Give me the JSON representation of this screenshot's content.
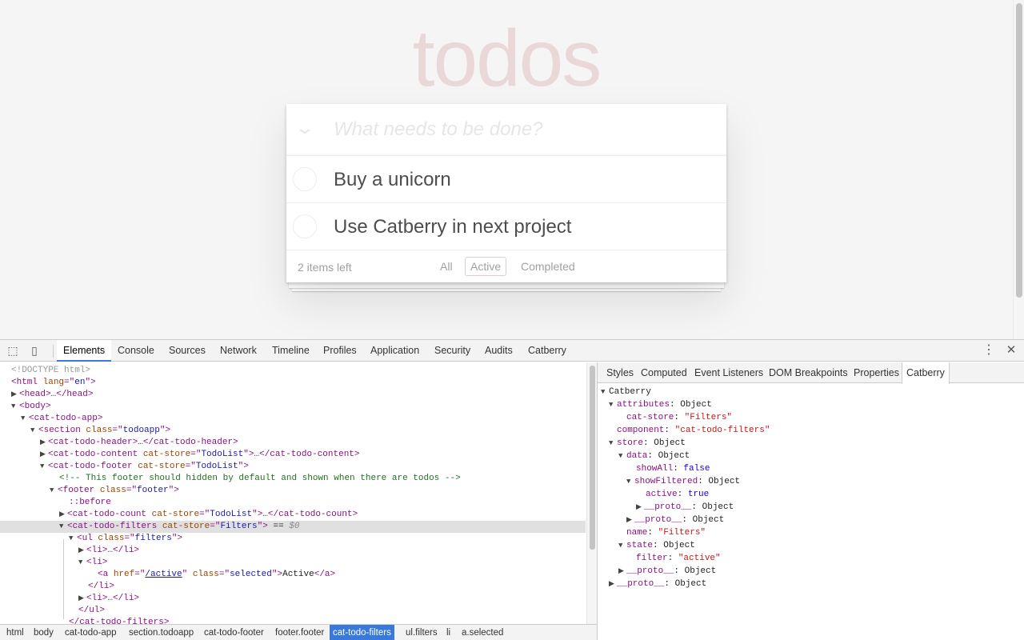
{
  "app": {
    "title": "todos",
    "new_todo_placeholder": "What needs to be done?",
    "toggle_all_glyph": "❯",
    "todos": [
      {
        "text": "Buy a unicorn",
        "completed": false
      },
      {
        "text": "Use Catberry in next project",
        "completed": false
      }
    ],
    "footer": {
      "count": "2 items left",
      "filters": [
        {
          "label": "All",
          "selected": false
        },
        {
          "label": "Active",
          "selected": true
        },
        {
          "label": "Completed",
          "selected": false
        }
      ]
    }
  },
  "devtools": {
    "tabs": [
      "Elements",
      "Console",
      "Sources",
      "Network",
      "Timeline",
      "Profiles",
      "Application",
      "Security",
      "Audits",
      "Catberry"
    ],
    "active_tab": "Elements",
    "icons": {
      "inspect": "inspect-icon",
      "device": "device-icon",
      "more": "more-vertical-icon",
      "close": "close-icon"
    },
    "dom": [
      {
        "t": "<!DOCTYPE html>"
      },
      {
        "a": "<",
        "b": "html",
        "c": " lang",
        "d": "=\"",
        "e": "en",
        "f": "\">"
      },
      {
        "tag": "<head>",
        "ell": "…",
        "close": "</head>"
      },
      {
        "tag": "<body>"
      },
      {
        "tag": "<cat-todo-app>"
      },
      {
        "tag": "<section",
        "attr": "class",
        "val": "todoapp",
        "end": ">"
      },
      {
        "tag": "<cat-todo-header>",
        "ell": "…",
        "close": "</cat-todo-header>"
      },
      {
        "tag": "<cat-todo-content",
        "attr": "cat-store",
        "val": "TodoList",
        "end": ">",
        "ell": "…",
        "close": "</cat-todo-content>"
      },
      {
        "tag": "<cat-todo-footer",
        "attr": "cat-store",
        "val": "TodoList",
        "end": ">"
      },
      {
        "comment": "<!-- This footer should hidden by default and shown when there are todos -->"
      },
      {
        "tag": "<footer",
        "attr": "class",
        "val": "footer",
        "end": ">"
      },
      {
        "pseudo": "::before"
      },
      {
        "tag": "<cat-todo-count",
        "attr": "cat-store",
        "val": "TodoList",
        "end": ">",
        "ell": "…",
        "close": "</cat-todo-count>"
      },
      {
        "tag": "<cat-todo-filters",
        "attr": "cat-store",
        "val": "Filters",
        "end": ">",
        "eq": " == ",
        "dollar": "$0"
      },
      {
        "tag": "<ul",
        "attr": "class",
        "val": "filters",
        "end": ">"
      },
      {
        "tag": "<li>",
        "ell": "…",
        "close": "</li>"
      },
      {
        "tag": "<li>"
      },
      {
        "tag": "<a",
        "attr": "href",
        "val": "/active",
        "attr2": "class",
        "val2": "selected",
        "end": ">",
        "text": "Active",
        "close": "</a>"
      },
      {
        "tag": "</li>"
      },
      {
        "tag": "<li>",
        "ell": "…",
        "close": "</li>"
      },
      {
        "tag": "</ul>"
      },
      {
        "tag": "</cat-todo-filters>"
      }
    ],
    "breadcrumbs": [
      "html",
      "body",
      "cat-todo-app",
      "section.todoapp",
      "cat-todo-footer",
      "footer.footer",
      "cat-todo-filters",
      "ul.filters",
      "li",
      "a.selected"
    ],
    "active_breadcrumb": "cat-todo-filters",
    "sidebar_tabs": [
      "Styles",
      "Computed",
      "Event Listeners",
      "DOM Breakpoints",
      "Properties",
      "Catberry"
    ],
    "active_sidebar_tab": "Catberry",
    "catberry_tree": [
      {
        "k": "Catberry"
      },
      {
        "k": "attributes",
        "v": "Object"
      },
      {
        "k": "cat-store",
        "s": "\"Filters\""
      },
      {
        "k": "component",
        "s": "\"cat-todo-filters\""
      },
      {
        "k": "store",
        "v": "Object"
      },
      {
        "k": "data",
        "v": "Object"
      },
      {
        "k": "showAll",
        "b": "false"
      },
      {
        "k": "showFiltered",
        "v": "Object"
      },
      {
        "k": "active",
        "b": "true"
      },
      {
        "k": "__proto__",
        "v": "Object"
      },
      {
        "k": "__proto__",
        "v": "Object"
      },
      {
        "k": "name",
        "s": "\"Filters\""
      },
      {
        "k": "state",
        "v": "Object"
      },
      {
        "k": "filter",
        "s": "\"active\""
      },
      {
        "k": "__proto__",
        "v": "Object"
      },
      {
        "k": "__proto__",
        "v": "Object"
      }
    ]
  }
}
